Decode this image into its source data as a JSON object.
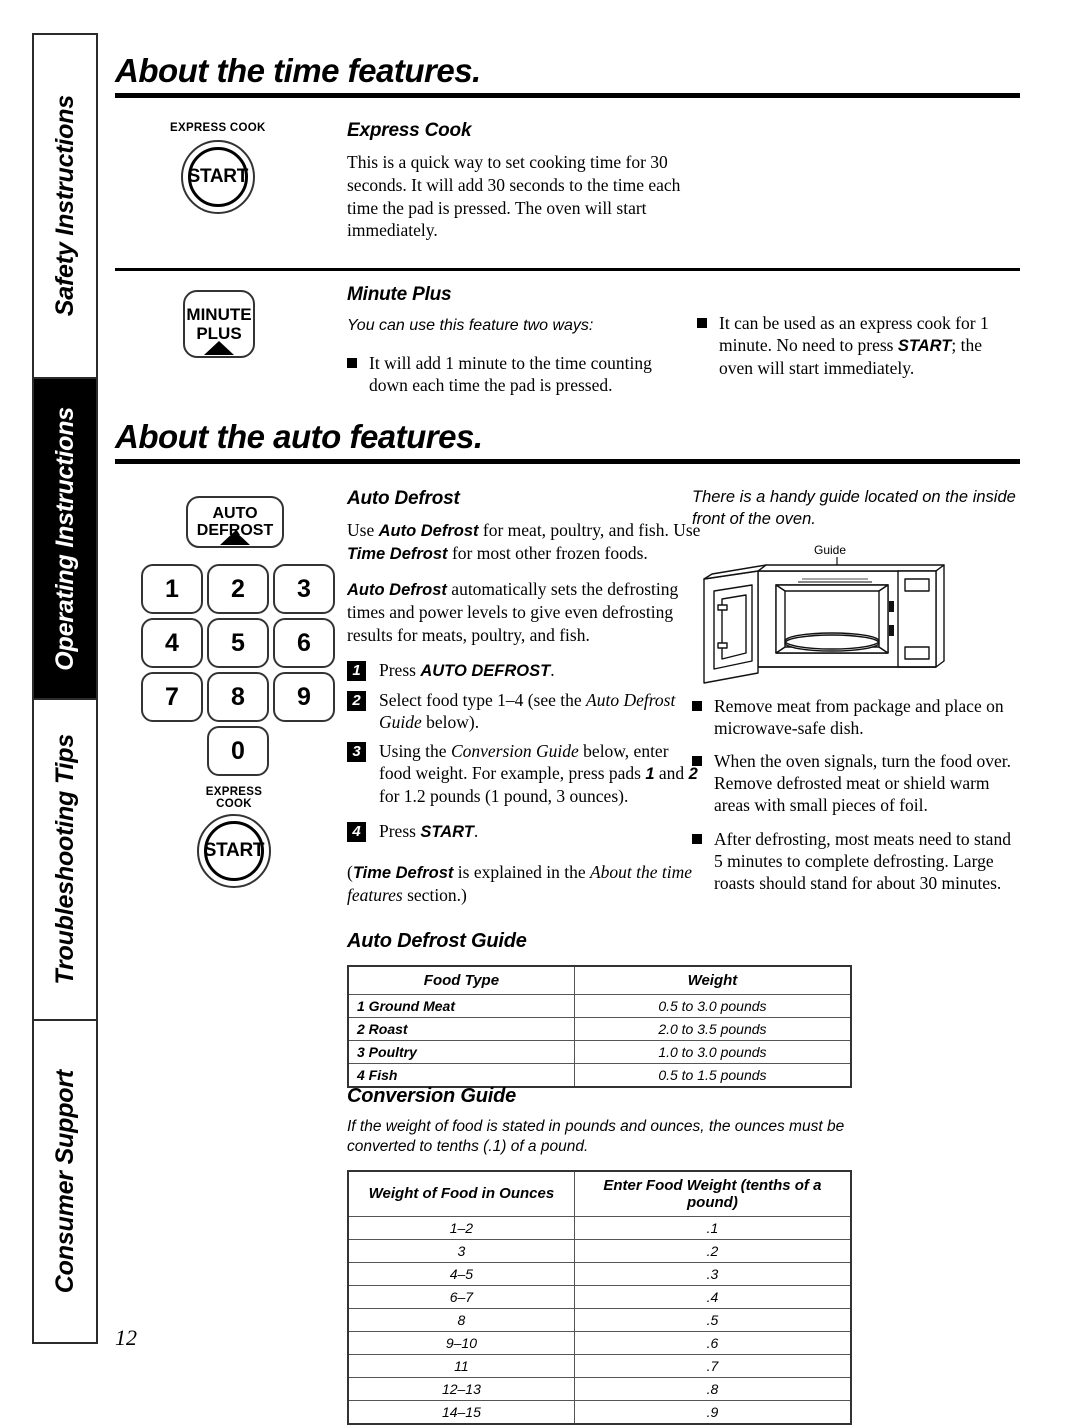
{
  "sidebar": {
    "tabs": [
      {
        "label": "Safety Instructions",
        "active": false
      },
      {
        "label": "Operating Instructions",
        "active": true
      },
      {
        "label": "Troubleshooting Tips",
        "active": false
      },
      {
        "label": "Consumer Support",
        "active": false
      }
    ]
  },
  "page_number": "12",
  "section_time": {
    "title": "About the time features.",
    "express_cook": {
      "key_label": "EXPRESS COOK",
      "key_button": "START",
      "heading": "Express Cook",
      "body": "This is a quick way to set cooking time for 30 seconds. It will add 30 seconds to the time each time the pad is pressed. The oven will start immediately."
    },
    "minute_plus": {
      "key_line1": "MINUTE",
      "key_line2": "PLUS",
      "heading": "Minute Plus",
      "intro": "You can use this feature two ways:",
      "bullet_left": "It will add 1 minute to the time counting down each time the pad is pressed.",
      "bullet_right_a": "It can be used as an express cook for 1 minute. No need to press ",
      "bullet_right_b": "START",
      "bullet_right_c": "; the oven will start immediately."
    }
  },
  "section_auto": {
    "title": "About the auto features.",
    "keypad": {
      "auto_defrost_line1": "AUTO",
      "auto_defrost_line2": "DEFROST",
      "digits": [
        "1",
        "2",
        "3",
        "4",
        "5",
        "6",
        "7",
        "8",
        "9",
        "0"
      ],
      "express_cook_label": "EXPRESS COOK",
      "start_label": "START"
    },
    "auto_defrost": {
      "heading": "Auto Defrost",
      "para1_a": "Use ",
      "para1_b": "Auto Defrost",
      "para1_c": " for meat, poultry, and fish. Use ",
      "para1_d": "Time Defrost",
      "para1_e": " for most other frozen foods.",
      "para2_a": "Auto Defrost",
      "para2_b": " automatically sets the defrosting times and power levels to give even defrosting results for meats, poultry, and fish.",
      "steps": [
        {
          "num": "1",
          "text_a": "Press ",
          "text_b": "AUTO DEFROST",
          "text_c": "."
        },
        {
          "num": "2",
          "text_a": "Select food type 1–4 (see the ",
          "text_b": "Auto Defrost Guide",
          "text_c": " below)."
        },
        {
          "num": "3",
          "text_a": "Using the ",
          "text_b": "Conversion Guide",
          "text_c": " below, enter food weight. For example, press pads ",
          "text_d": "1",
          "text_e": " and ",
          "text_f": "2",
          "text_g": " for 1.2 pounds (1 pound, 3 ounces)."
        },
        {
          "num": "4",
          "text_a": "Press ",
          "text_b": "START",
          "text_c": "."
        }
      ],
      "footnote_a": "(",
      "footnote_b": "Time Defrost",
      "footnote_c": " is explained in the ",
      "footnote_d": "About the time features",
      "footnote_e": " section.)"
    },
    "right_column": {
      "note": "There is a handy guide located on the inside front of the oven.",
      "oven_caption": "Guide",
      "bullets": [
        "Remove meat from package and place on microwave-safe dish.",
        "When the oven signals, turn the food over. Remove defrosted meat or shield warm areas with small pieces of foil.",
        "After defrosting, most meats need to stand 5 minutes to complete defrosting. Large roasts should stand for about 30 minutes."
      ]
    },
    "auto_defrost_guide": {
      "heading": "Auto Defrost Guide",
      "columns": [
        "Food Type",
        "Weight"
      ],
      "rows": [
        [
          "1 Ground Meat",
          "0.5 to 3.0 pounds"
        ],
        [
          "2 Roast",
          "2.0 to 3.5 pounds"
        ],
        [
          "3 Poultry",
          "1.0 to 3.0 pounds"
        ],
        [
          "4 Fish",
          "0.5 to 1.5 pounds"
        ]
      ]
    },
    "conversion_guide": {
      "heading": "Conversion Guide",
      "intro": "If the weight of food is stated in pounds and ounces, the ounces must be converted to tenths (.1) of a pound.",
      "columns": [
        "Weight of Food in Ounces",
        "Enter Food Weight (tenths of a pound)"
      ],
      "rows": [
        [
          "1–2",
          ".1"
        ],
        [
          "3",
          ".2"
        ],
        [
          "4–5",
          ".3"
        ],
        [
          "6–7",
          ".4"
        ],
        [
          "8",
          ".5"
        ],
        [
          "9–10",
          ".6"
        ],
        [
          "11",
          ".7"
        ],
        [
          "12–13",
          ".8"
        ],
        [
          "14–15",
          ".9"
        ]
      ]
    }
  },
  "colors": {
    "ink": "#000000",
    "rule": "#2b2b2b",
    "tab_active_bg": "#000000"
  }
}
